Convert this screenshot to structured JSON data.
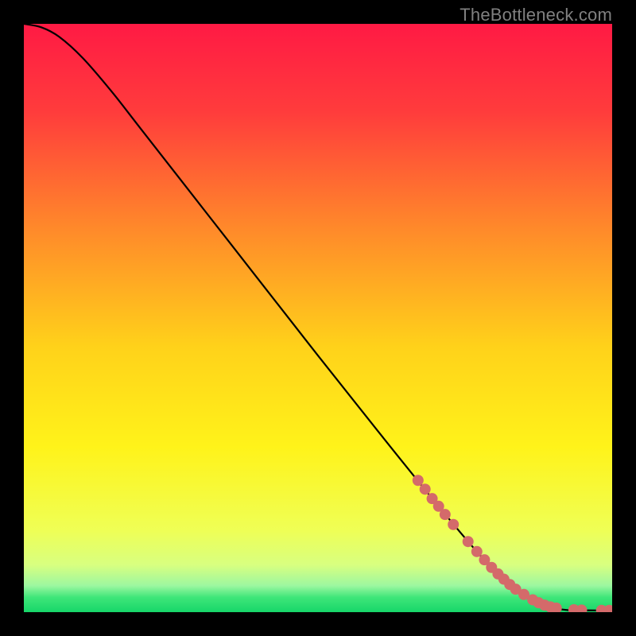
{
  "watermark": "TheBottleneck.com",
  "chart_data": {
    "type": "line",
    "title": "",
    "xlabel": "",
    "ylabel": "",
    "xlim": [
      0,
      100
    ],
    "ylim": [
      0,
      100
    ],
    "grid": false,
    "legend": false,
    "gradient_stops": [
      {
        "offset": 0.0,
        "color": "#ff1a44"
      },
      {
        "offset": 0.15,
        "color": "#ff3c3c"
      },
      {
        "offset": 0.35,
        "color": "#ff8a2a"
      },
      {
        "offset": 0.55,
        "color": "#ffd21a"
      },
      {
        "offset": 0.72,
        "color": "#fff31a"
      },
      {
        "offset": 0.86,
        "color": "#efff55"
      },
      {
        "offset": 0.92,
        "color": "#d8ff80"
      },
      {
        "offset": 0.955,
        "color": "#9cf7a0"
      },
      {
        "offset": 0.975,
        "color": "#3ee679"
      },
      {
        "offset": 1.0,
        "color": "#17d669"
      }
    ],
    "curve": [
      {
        "x": 0,
        "y": 100.0
      },
      {
        "x": 3,
        "y": 99.4
      },
      {
        "x": 6,
        "y": 97.8
      },
      {
        "x": 10,
        "y": 94.2
      },
      {
        "x": 15,
        "y": 88.4
      },
      {
        "x": 20,
        "y": 82.0
      },
      {
        "x": 30,
        "y": 69.2
      },
      {
        "x": 40,
        "y": 56.4
      },
      {
        "x": 50,
        "y": 43.6
      },
      {
        "x": 60,
        "y": 31.0
      },
      {
        "x": 70,
        "y": 18.6
      },
      {
        "x": 78,
        "y": 9.2
      },
      {
        "x": 84,
        "y": 3.6
      },
      {
        "x": 88,
        "y": 1.2
      },
      {
        "x": 92,
        "y": 0.4
      },
      {
        "x": 96,
        "y": 0.3
      },
      {
        "x": 100,
        "y": 0.3
      }
    ],
    "points_series": {
      "name": "highlighted",
      "color": "#d46a6a",
      "radius": 7,
      "points": [
        {
          "x": 67.0,
          "y": 22.4
        },
        {
          "x": 68.2,
          "y": 20.9
        },
        {
          "x": 69.4,
          "y": 19.3
        },
        {
          "x": 70.5,
          "y": 18.0
        },
        {
          "x": 71.6,
          "y": 16.6
        },
        {
          "x": 73.0,
          "y": 14.9
        },
        {
          "x": 75.5,
          "y": 12.0
        },
        {
          "x": 77.0,
          "y": 10.3
        },
        {
          "x": 78.3,
          "y": 8.9
        },
        {
          "x": 79.5,
          "y": 7.6
        },
        {
          "x": 80.6,
          "y": 6.5
        },
        {
          "x": 81.6,
          "y": 5.6
        },
        {
          "x": 82.6,
          "y": 4.7
        },
        {
          "x": 83.6,
          "y": 3.9
        },
        {
          "x": 85.0,
          "y": 3.0
        },
        {
          "x": 86.5,
          "y": 2.1
        },
        {
          "x": 87.5,
          "y": 1.6
        },
        {
          "x": 88.5,
          "y": 1.2
        },
        {
          "x": 89.5,
          "y": 0.9
        },
        {
          "x": 90.5,
          "y": 0.7
        },
        {
          "x": 93.5,
          "y": 0.4
        },
        {
          "x": 94.8,
          "y": 0.35
        },
        {
          "x": 98.2,
          "y": 0.3
        },
        {
          "x": 99.5,
          "y": 0.3
        }
      ]
    }
  }
}
